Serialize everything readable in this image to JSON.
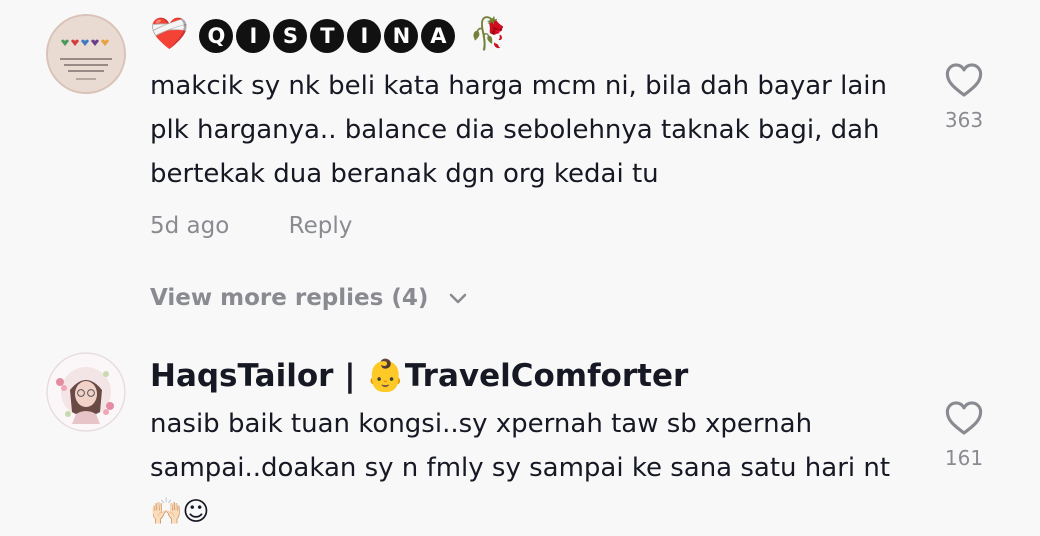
{
  "comments": [
    {
      "username_prefix_emoji": "❤️‍🩹",
      "username_letters": [
        "Q",
        "I",
        "S",
        "T",
        "I",
        "N",
        "A"
      ],
      "username_suffix_emoji": "🥀",
      "text": "makcik sy nk beli kata harga mcm ni, bila dah bayar lain plk harganya.. balance dia sebolehnya taknak bagi, dah bertekak dua beranak dgn org kedai tu",
      "time": "5d ago",
      "reply_label": "Reply",
      "like_count": "363",
      "more_replies_label": "View more replies (4)"
    },
    {
      "username": "HaqsTailor | 👶TravelComforter",
      "text": "nasib baik tuan kongsi..sy xpernah taw sb xpernah sampai..doakan sy n fmly sy sampai ke sana satu hari nt🙌🏻☺",
      "like_count": "161"
    }
  ],
  "colors": {
    "background": "#f8f8f8",
    "primary_text": "#161823",
    "secondary_text": "#8a8b91"
  },
  "icons": {
    "like": "heart-outline-icon",
    "expand": "chevron-down-icon"
  }
}
